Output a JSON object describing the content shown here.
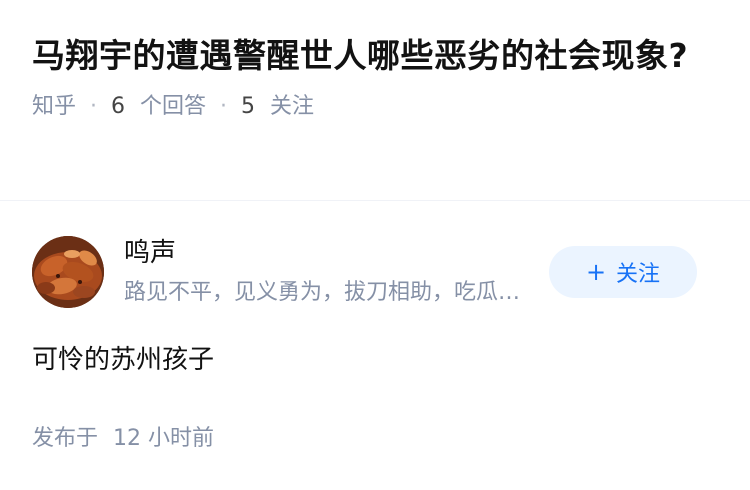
{
  "question": {
    "title": "马翔宇的遭遇警醒世人哪些恶劣的社会现象?",
    "source": "知乎",
    "answer_count": "6",
    "answer_label": "个回答",
    "follower_count": "5",
    "follower_label": "关注",
    "separator": "·"
  },
  "author": {
    "name": "鸣声",
    "bio": "路见不平，见义勇为，拔刀相助，吃瓜群众，热心网友",
    "follow_plus": "+",
    "follow_label": "关注"
  },
  "answer": {
    "content": "可怜的苏州孩子",
    "published_prefix": "发布于",
    "published_time": "12 小时前"
  },
  "colors": {
    "accent": "#1772f6",
    "follow_bg": "#ebf4ff",
    "meta_gray": "#8590a6"
  }
}
